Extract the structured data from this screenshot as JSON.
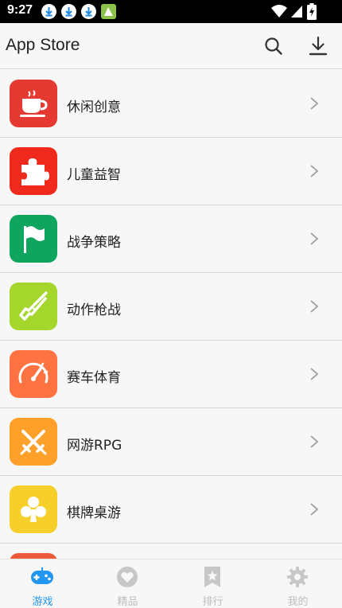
{
  "status_bar": {
    "time": "9:27"
  },
  "app_bar": {
    "title": "App Store"
  },
  "categories": [
    {
      "label": "休闲创意",
      "color": "#e53a32",
      "icon": "coffee-cup-icon"
    },
    {
      "label": "儿童益智",
      "color": "#ef2a1d",
      "icon": "puzzle-icon"
    },
    {
      "label": "战争策略",
      "color": "#0fa55f",
      "icon": "flag-icon"
    },
    {
      "label": "动作枪战",
      "color": "#a4d62b",
      "icon": "rifle-icon"
    },
    {
      "label": "赛车体育",
      "color": "#ff7342",
      "icon": "speedometer-icon"
    },
    {
      "label": "网游RPG",
      "color": "#ffa02a",
      "icon": "crossed-swords-icon"
    },
    {
      "label": "棋牌桌游",
      "color": "#f6cf2a",
      "icon": "club-icon"
    }
  ],
  "tabs": [
    {
      "label": "游戏",
      "icon": "gamepad-icon",
      "active": true
    },
    {
      "label": "精品",
      "icon": "heart-icon",
      "active": false
    },
    {
      "label": "排行",
      "icon": "bookmark-star-icon",
      "active": false
    },
    {
      "label": "我的",
      "icon": "gear-icon",
      "active": false
    }
  ],
  "colors": {
    "accent": "#2196f3",
    "inactive": "#bdbdbd"
  }
}
